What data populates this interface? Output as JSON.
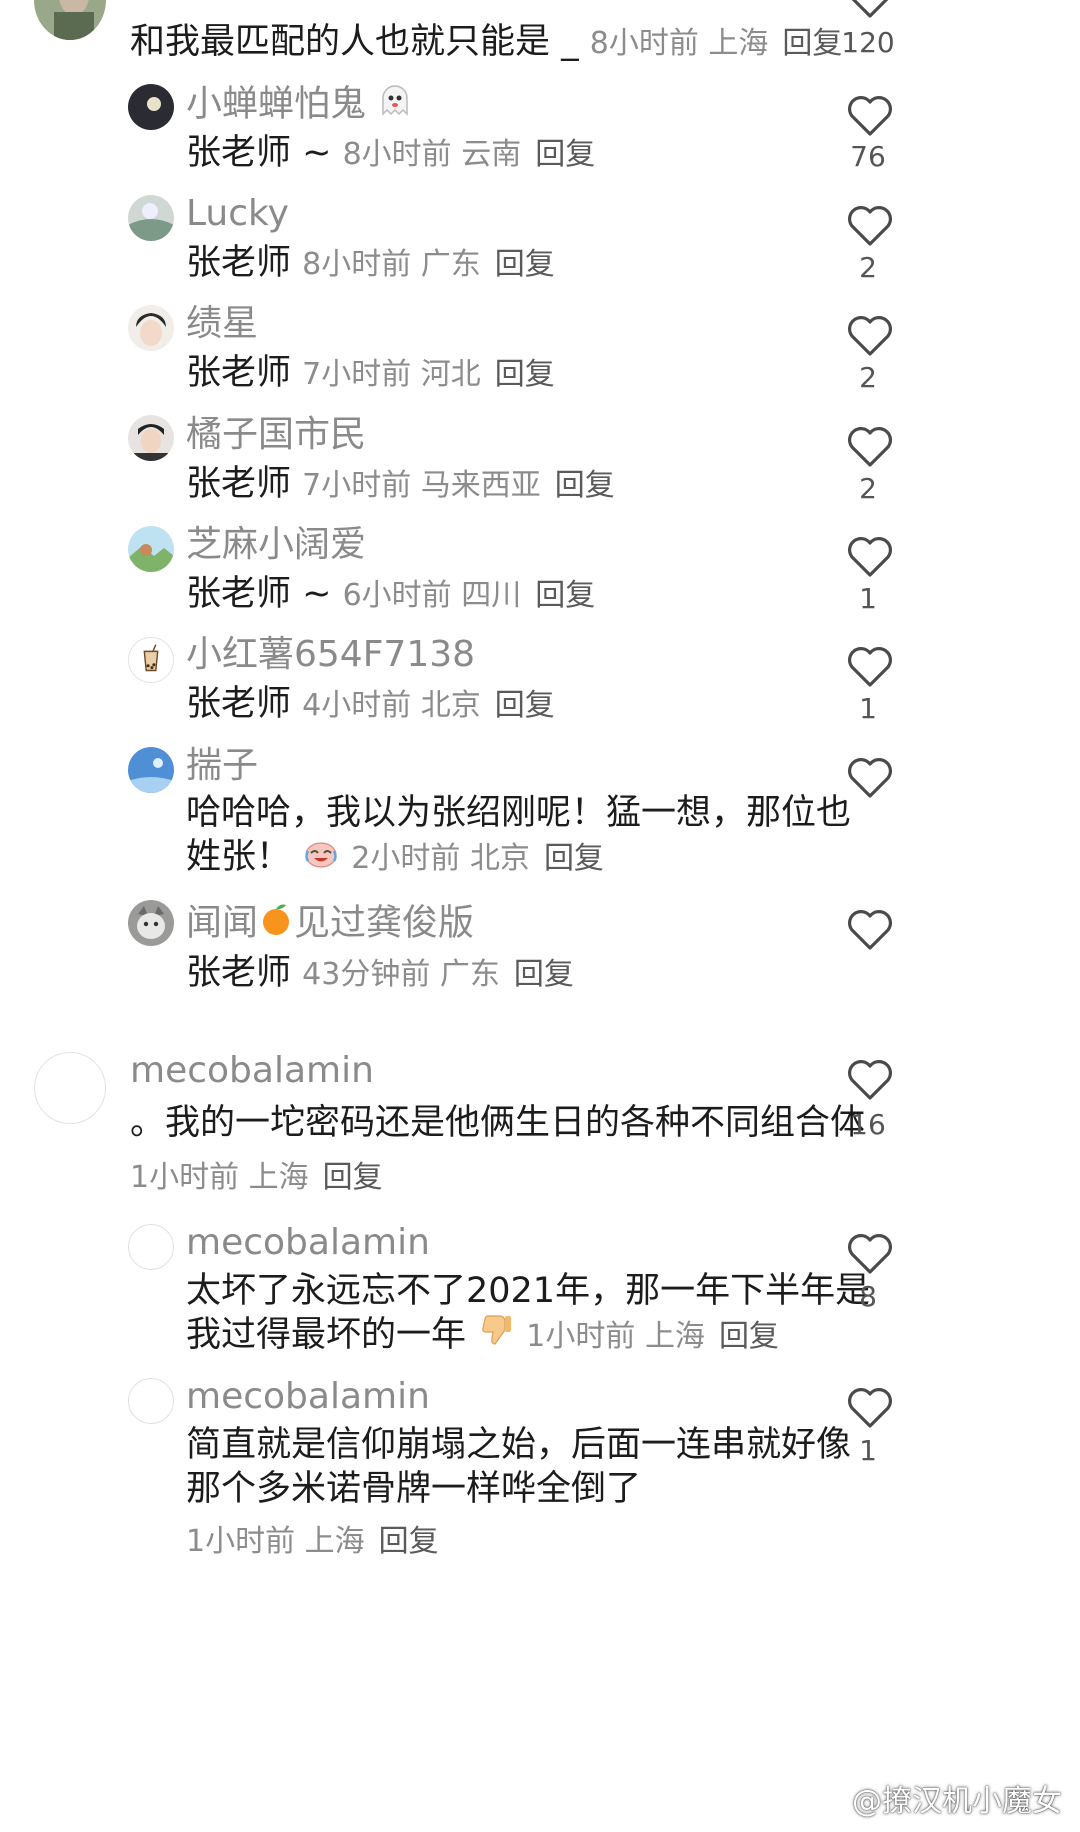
{
  "top_comment": {
    "text": "和我最匹配的人也就只能是 _",
    "time": "8小时前",
    "location": "上海",
    "reply": "回复",
    "likes": "120"
  },
  "replies_a": [
    {
      "name": "小蝉蝉怕鬼",
      "text": "张老师 ~",
      "time": "8小时前",
      "location": "云南",
      "reply": "回复",
      "likes": "76"
    },
    {
      "name": "Lucky",
      "text": "张老师",
      "time": "8小时前",
      "location": "广东",
      "reply": "回复",
      "likes": "2"
    },
    {
      "name": "绩星",
      "text": "张老师",
      "time": "7小时前",
      "location": "河北",
      "reply": "回复",
      "likes": "2"
    },
    {
      "name": "橘子国市民",
      "text": "张老师",
      "time": "7小时前",
      "location": "马来西亚",
      "reply": "回复",
      "likes": "2"
    },
    {
      "name": "芝麻小阔爱",
      "text": "张老师 ~",
      "time": "6小时前",
      "location": "四川",
      "reply": "回复",
      "likes": "1"
    },
    {
      "name": "小红薯654F7138",
      "text": "张老师",
      "time": "4小时前",
      "location": "北京",
      "reply": "回复",
      "likes": "1"
    }
  ],
  "reply_chuaizi": {
    "name": "揣子",
    "text_line1": "哈哈哈，我以为张绍刚呢！猛一想，那位也",
    "text_line2": "姓张！",
    "time": "2小时前",
    "location": "北京",
    "reply": "回复",
    "likes": ""
  },
  "reply_wenwen": {
    "name_part1": "闻闻",
    "name_part2": "见过龚俊版",
    "text": "张老师",
    "time": "43分钟前",
    "location": "广东",
    "reply": "回复",
    "likes": ""
  },
  "main_comment": {
    "name": "mecobalamin",
    "text": "。我的一坨密码还是他俩生日的各种不同组合体",
    "time": "1小时前",
    "location": "上海",
    "reply": "回复",
    "likes": "16"
  },
  "main_replies": [
    {
      "name": "mecobalamin",
      "text_line1": "太坏了永远忘不了2021年，那一年下半年是",
      "text_line2": "我过得最坏的一年",
      "time": "1小时前",
      "location": "上海",
      "reply": "回复",
      "likes": "8"
    },
    {
      "name": "mecobalamin",
      "text_line1": "简直就是信仰崩塌之始，后面一连串就好像",
      "text_line2": "那个多米诺骨牌一样哗全倒了",
      "time": "1小时前",
      "location": "上海",
      "reply": "回复",
      "likes": "1"
    }
  ],
  "watermark": "@撩汉机小魔女",
  "colors": {
    "username": "#8a8a8a",
    "meta": "#8c8c8c",
    "heart": "#4a4a4a",
    "text": "#1c1c1c"
  }
}
